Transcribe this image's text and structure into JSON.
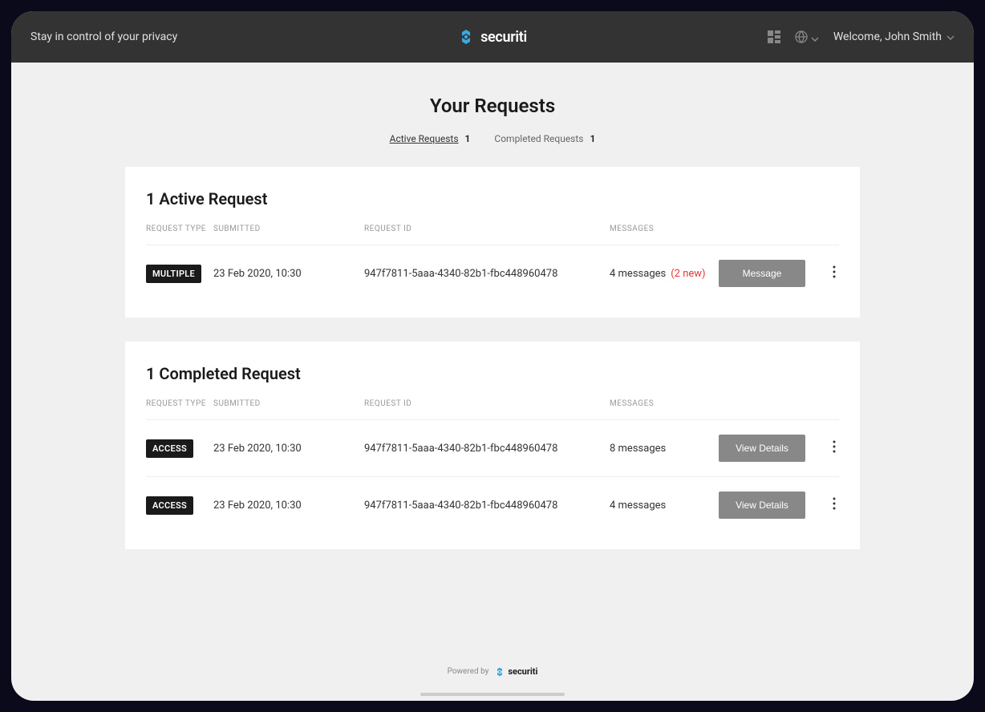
{
  "header": {
    "tagline": "Stay in control of your privacy",
    "brand": "securiti",
    "welcome": "Welcome, John Smith"
  },
  "page": {
    "title": "Your Requests"
  },
  "tabs": {
    "active": {
      "label": "Active Requests",
      "count": "1"
    },
    "completed": {
      "label": "Completed Requests",
      "count": "1"
    }
  },
  "active_section": {
    "title": "1 Active Request",
    "columns": {
      "type": "REQUEST TYPE",
      "submitted": "SUBMITTED",
      "request_id": "REQUEST ID",
      "messages": "MESSAGES"
    },
    "rows": [
      {
        "type": "MULTIPLE",
        "submitted": "23 Feb 2020, 10:30",
        "request_id": "947f7811-5aaa-4340-82b1-fbc448960478",
        "messages": "4 messages",
        "new": "(2 new)",
        "action": "Message"
      }
    ]
  },
  "completed_section": {
    "title": "1 Completed Request",
    "columns": {
      "type": "REQUEST TYPE",
      "submitted": "SUBMITTED",
      "request_id": "REQUEST ID",
      "messages": "MESSAGES"
    },
    "rows": [
      {
        "type": "ACCESS",
        "submitted": "23 Feb 2020, 10:30",
        "request_id": "947f7811-5aaa-4340-82b1-fbc448960478",
        "messages": "8 messages",
        "action": "View Details"
      },
      {
        "type": "ACCESS",
        "submitted": "23 Feb 2020, 10:30",
        "request_id": "947f7811-5aaa-4340-82b1-fbc448960478",
        "messages": "4 messages",
        "action": "View Details"
      }
    ]
  },
  "footer": {
    "powered_by": "Powered by",
    "brand": "securiti"
  }
}
